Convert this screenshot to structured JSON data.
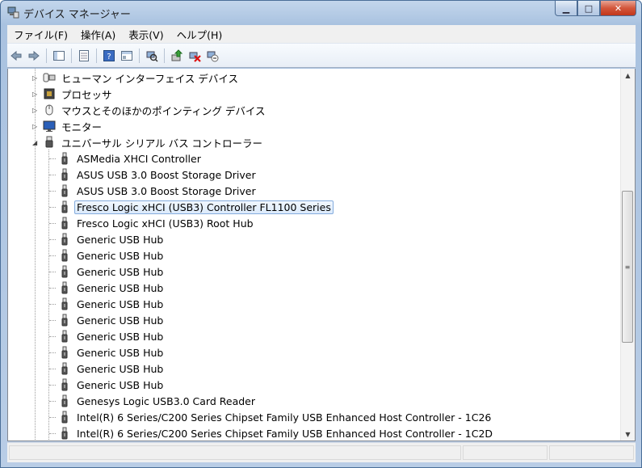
{
  "window": {
    "title": "デバイス マネージャー",
    "caption_buttons": {
      "minimize": "▁",
      "maximize": "□",
      "close": "✕"
    }
  },
  "menu": [
    {
      "label": "ファイル(F)"
    },
    {
      "label": "操作(A)"
    },
    {
      "label": "表示(V)"
    },
    {
      "label": "ヘルプ(H)"
    }
  ],
  "toolbar": [
    {
      "name": "back-arrow-icon"
    },
    {
      "name": "forward-arrow-icon"
    },
    {
      "name": "show-hide-console-tree-icon"
    },
    {
      "name": "properties-icon"
    },
    {
      "name": "help-icon"
    },
    {
      "name": "console-tree-view-icon"
    },
    {
      "name": "scan-hardware-changes-icon"
    },
    {
      "name": "update-driver-icon"
    },
    {
      "name": "uninstall-device-icon"
    },
    {
      "name": "disable-device-icon"
    }
  ],
  "tree": {
    "categories": [
      {
        "label": "ヒューマン インターフェイス デバイス",
        "icon": "hid-icon",
        "expanded": false
      },
      {
        "label": "プロセッサ",
        "icon": "processor-icon",
        "expanded": false
      },
      {
        "label": "マウスとそのほかのポインティング デバイス",
        "icon": "mouse-icon",
        "expanded": false
      },
      {
        "label": "モニター",
        "icon": "monitor-icon",
        "expanded": false
      },
      {
        "label": "ユニバーサル シリアル バス コントローラー",
        "icon": "usb-icon",
        "expanded": true
      }
    ],
    "usb_devices": [
      {
        "label": "ASMedia XHCI Controller",
        "selected": false
      },
      {
        "label": "ASUS USB 3.0 Boost Storage Driver",
        "selected": false
      },
      {
        "label": "ASUS USB 3.0 Boost Storage Driver",
        "selected": false
      },
      {
        "label": "Fresco Logic xHCI (USB3) Controller FL1100 Series",
        "selected": true
      },
      {
        "label": "Fresco Logic xHCI (USB3) Root Hub",
        "selected": false
      },
      {
        "label": "Generic USB Hub",
        "selected": false
      },
      {
        "label": "Generic USB Hub",
        "selected": false
      },
      {
        "label": "Generic USB Hub",
        "selected": false
      },
      {
        "label": "Generic USB Hub",
        "selected": false
      },
      {
        "label": "Generic USB Hub",
        "selected": false
      },
      {
        "label": "Generic USB Hub",
        "selected": false
      },
      {
        "label": "Generic USB Hub",
        "selected": false
      },
      {
        "label": "Generic USB Hub",
        "selected": false
      },
      {
        "label": "Generic USB Hub",
        "selected": false
      },
      {
        "label": "Generic USB Hub",
        "selected": false
      },
      {
        "label": "Genesys Logic USB3.0 Card Reader",
        "selected": false
      },
      {
        "label": "Intel(R) 6 Series/C200 Series Chipset Family USB Enhanced Host Controller - 1C26",
        "selected": false
      },
      {
        "label": "Intel(R) 6 Series/C200 Series Chipset Family USB Enhanced Host Controller - 1C2D",
        "selected": false
      }
    ]
  },
  "scrollbar": {
    "up": "▲",
    "down": "▼",
    "grip": "≡"
  },
  "colors": {
    "selection_border": "#84acdd",
    "selection_fill": "#dbeafb",
    "frame": "#b9cde6"
  }
}
